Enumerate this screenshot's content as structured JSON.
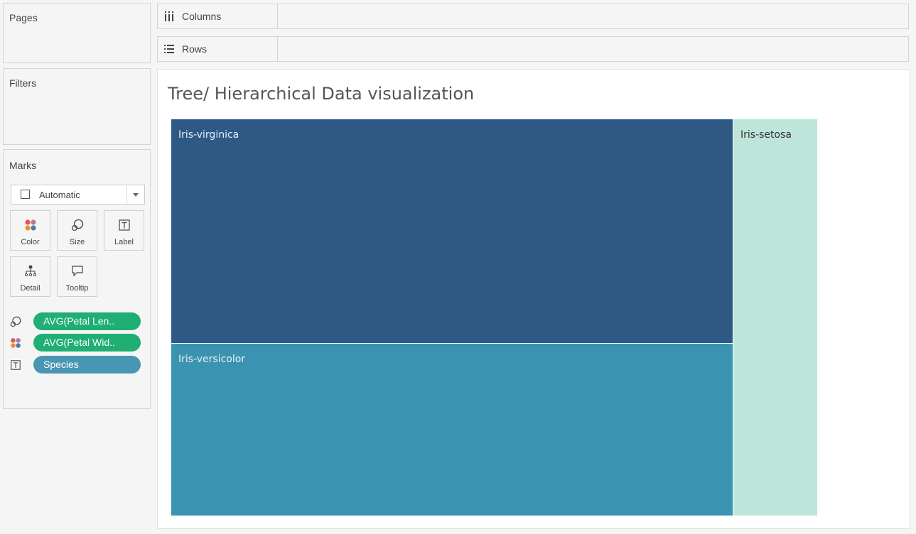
{
  "left_panel": {
    "pages_title": "Pages",
    "filters_title": "Filters",
    "marks_title": "Marks",
    "mark_type": "Automatic",
    "mark_buttons": [
      {
        "label": "Color",
        "icon": "color-dots-icon"
      },
      {
        "label": "Size",
        "icon": "size-circles-icon"
      },
      {
        "label": "Label",
        "icon": "text-label-icon"
      },
      {
        "label": "Detail",
        "icon": "detail-hierarchy-icon"
      },
      {
        "label": "Tooltip",
        "icon": "tooltip-bubble-icon"
      }
    ],
    "pills": [
      {
        "icon": "size-circles-icon",
        "text": "AVG(Petal Len..",
        "color": "#1fae74"
      },
      {
        "icon": "color-dots-icon",
        "text": "AVG(Petal Wid..",
        "color": "#1fae74"
      },
      {
        "icon": "text-label-icon",
        "text": "Species",
        "color": "#4996b2"
      }
    ]
  },
  "shelves": {
    "columns_label": "Columns",
    "rows_label": "Rows"
  },
  "view": {
    "title": "Tree/ Hierarchical Data visualization"
  },
  "chart_data": {
    "type": "treemap",
    "title": "Tree/ Hierarchical Data visualization",
    "size_measure": "AVG(Petal Length)",
    "color_measure": "AVG(Petal Width)",
    "label_field": "Species",
    "categories": [
      "Iris-virginica",
      "Iris-versicolor",
      "Iris-setosa"
    ],
    "values": [
      5.55,
      4.26,
      1.46
    ],
    "colors": [
      "#2e5985",
      "#3a93b0",
      "#bde5da"
    ],
    "label_colors": [
      "#e8eef5",
      "#e8f3f7",
      "#333333"
    ]
  }
}
